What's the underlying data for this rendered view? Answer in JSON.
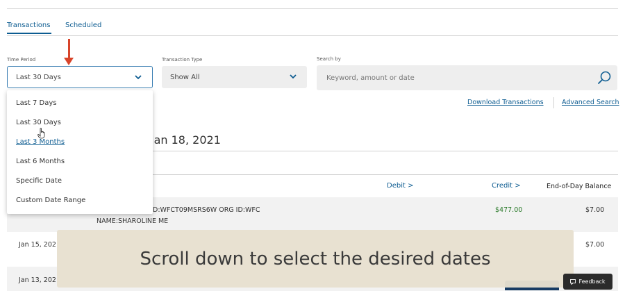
{
  "tabs": [
    {
      "label": "Transactions",
      "active": true
    },
    {
      "label": "Scheduled",
      "active": false
    }
  ],
  "filters": {
    "time_period": {
      "label": "Time Period",
      "value": "Last 30 Days"
    },
    "transaction_type": {
      "label": "Transaction Type",
      "value": "Show All"
    },
    "search": {
      "label": "Search by",
      "placeholder": "Keyword, amount or date"
    }
  },
  "dropdown": {
    "options": [
      "Last 7 Days",
      "Last 30 Days",
      "Last 3 Months",
      "Last 6 Months",
      "Specific Date",
      "Custom Date Range"
    ],
    "hovered": "Last 3 Months"
  },
  "links": {
    "download": "Download Transactions",
    "advanced": "Advanced Search"
  },
  "date_range_partial": "o Jan 18, 2021",
  "columns": {
    "debit": "Debit >",
    "credit": "Credit >",
    "balance": "End-of-Day Balance"
  },
  "rows": [
    {
      "desc_line1": "D:WFCT09MSRS6W ORG ID:WFC",
      "desc_line2": "NAME:SHAROLINE ME",
      "credit": "$477.00",
      "balance": "$7.00"
    },
    {
      "date": "Jan 15, 202",
      "balance": "$7.00"
    },
    {
      "date": "Jan 13, 202"
    }
  ],
  "caption": "Scroll down to select the desired dates",
  "feedback_label": "Feedback",
  "colors": {
    "link": "#0d5c91",
    "arrow": "#d8442a",
    "credit": "#2a7a2a",
    "caption_bg": "#e7e0cf"
  }
}
